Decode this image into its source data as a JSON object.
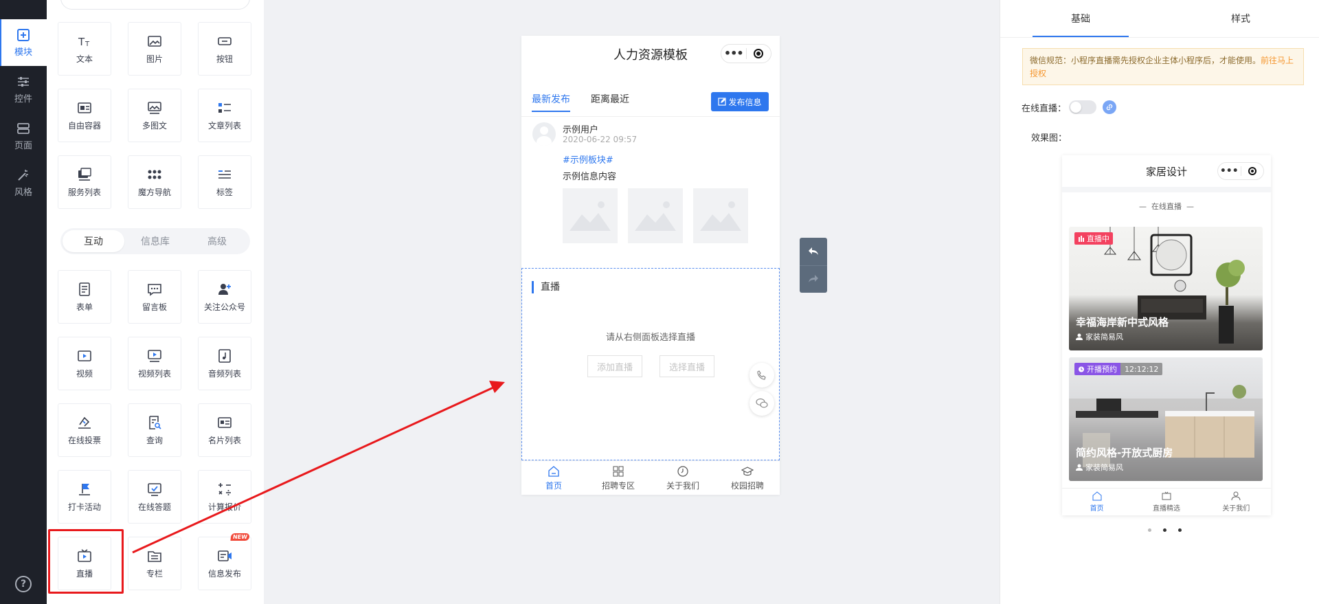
{
  "rail": {
    "items": [
      {
        "label": "模块",
        "icon": "plus-square-icon",
        "active": true
      },
      {
        "label": "控件",
        "icon": "sliders-icon"
      },
      {
        "label": "页面",
        "icon": "pages-icon"
      },
      {
        "label": "风格",
        "icon": "magic-wand-icon"
      }
    ],
    "help": "?"
  },
  "widgets": {
    "group1": [
      {
        "label": "文本",
        "icon": "text-icon"
      },
      {
        "label": "图片",
        "icon": "image-icon"
      },
      {
        "label": "按钮",
        "icon": "button-icon"
      },
      {
        "label": "自由容器",
        "icon": "container-icon"
      },
      {
        "label": "多图文",
        "icon": "multi-image-icon"
      },
      {
        "label": "文章列表",
        "icon": "article-list-icon"
      },
      {
        "label": "服务列表",
        "icon": "service-list-icon"
      },
      {
        "label": "魔方导航",
        "icon": "grid-dots-icon"
      },
      {
        "label": "标签",
        "icon": "tabs-icon"
      }
    ],
    "segments": [
      "互动",
      "信息库",
      "高级"
    ],
    "group2": [
      {
        "label": "表单",
        "icon": "form-icon"
      },
      {
        "label": "留言板",
        "icon": "message-board-icon"
      },
      {
        "label": "关注公众号",
        "icon": "follow-user-icon"
      },
      {
        "label": "视频",
        "icon": "video-icon"
      },
      {
        "label": "视频列表",
        "icon": "video-list-icon"
      },
      {
        "label": "音频列表",
        "icon": "audio-list-icon"
      },
      {
        "label": "在线投票",
        "icon": "vote-icon"
      },
      {
        "label": "查询",
        "icon": "search-doc-icon"
      },
      {
        "label": "名片列表",
        "icon": "card-list-icon"
      },
      {
        "label": "打卡活动",
        "icon": "checkin-flag-icon"
      },
      {
        "label": "在线答题",
        "icon": "quiz-icon"
      },
      {
        "label": "计算报价",
        "icon": "calculator-icon"
      },
      {
        "label": "直播",
        "icon": "tv-live-icon"
      },
      {
        "label": "专栏",
        "icon": "column-folder-icon"
      },
      {
        "label": "信息发布",
        "icon": "info-publish-icon",
        "badge": "NEW"
      }
    ]
  },
  "preview": {
    "title": "人力资源模板",
    "tabs": [
      "最新发布",
      "距离最近"
    ],
    "publish_label": "发布信息",
    "post": {
      "user": "示例用户",
      "time": "2020-06-22 09:57",
      "tag": "#示例板块#",
      "text": "示例信息内容"
    },
    "live": {
      "title": "直播",
      "hint": "请从右侧面板选择直播",
      "add_label": "添加直播",
      "select_label": "选择直播"
    },
    "nav": [
      "首页",
      "招聘专区",
      "关于我们",
      "校园招聘"
    ]
  },
  "settings": {
    "tabs": [
      "基础",
      "样式"
    ],
    "notice_text": "微信规范：小程序直播需先授权企业主体小程序后，才能使用。",
    "notice_link": "前往马上授权",
    "toggle_label": "在线直播：",
    "effect_label": "效果图：",
    "mini": {
      "title": "家居设计",
      "section": "在线直播",
      "card1": {
        "chip": "直播中",
        "title": "幸福海岸新中式风格",
        "sub": "家装简易风"
      },
      "card2": {
        "chip": "开播预约",
        "time": "12:12:12",
        "title": "简约风格-开放式厨房",
        "sub": "家装简易风"
      },
      "nav": [
        "首页",
        "直播精选",
        "关于我们"
      ]
    }
  },
  "colors": {
    "accent": "#2e77ee",
    "highlight": "#e8191c",
    "rail": "#1e2129"
  }
}
